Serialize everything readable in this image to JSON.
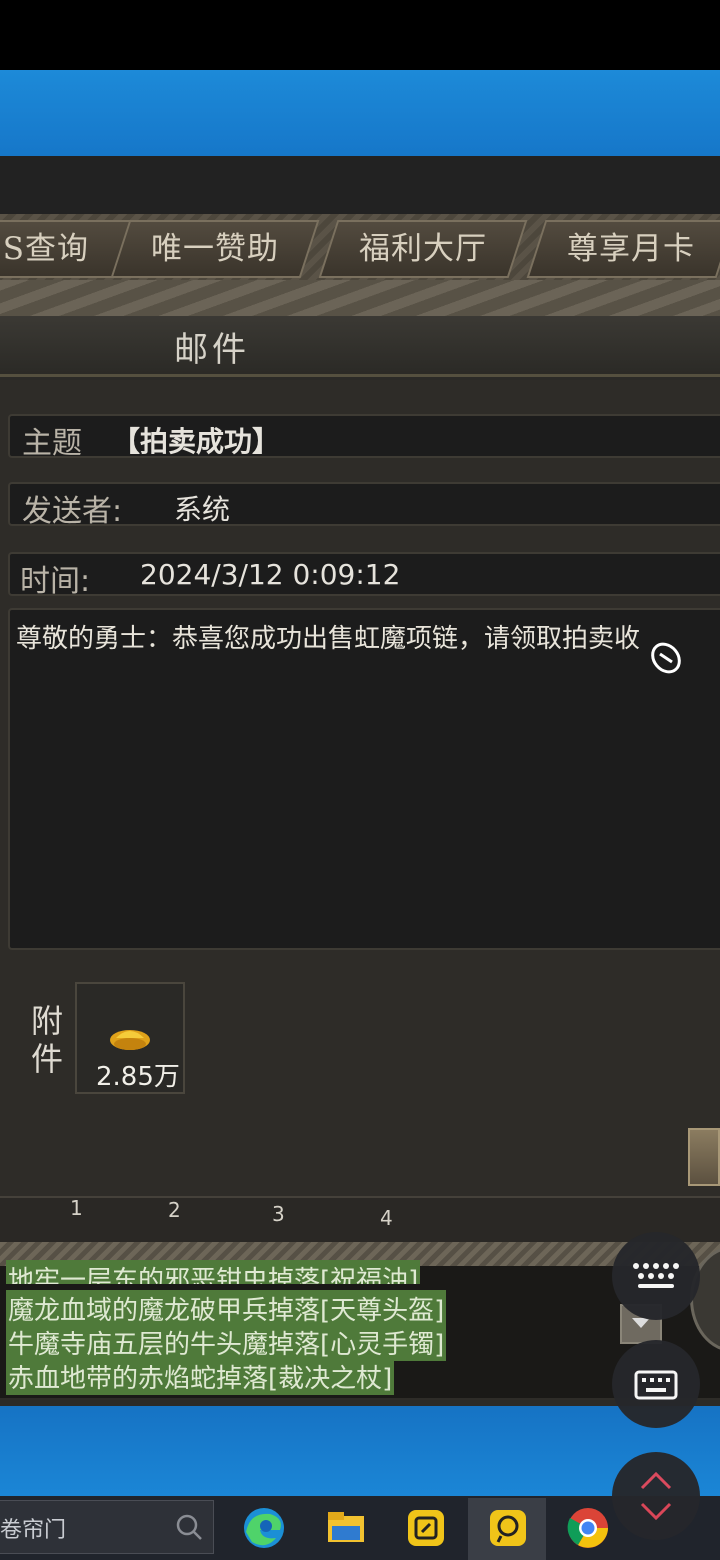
{
  "tabs": [
    "SS查询",
    "唯一赞助",
    "福利大厅",
    "尊享月卡"
  ],
  "mail": {
    "title": "邮件",
    "subject_label": "主题",
    "subject_value": "【拍卖成功】",
    "sender_label": "发送者:",
    "sender_value": "系统",
    "time_label": "时间:",
    "time_value": "2024/3/12 0:09:12",
    "content": "尊敬的勇士：恭喜您成功出售虹魔项链，请领取拍卖收",
    "attachment_label": "附件",
    "attachment_amount": "2.85万"
  },
  "pages": [
    "1",
    "2",
    "3",
    "4"
  ],
  "chat": {
    "lines": [
      "地牢一层东的邪恶钳虫掉落[祝福油]",
      "魔龙血域的魔龙破甲兵掉落[天尊头盔]",
      "牛魔寺庙五层的牛头魔掉落[心灵手镯]",
      "赤血地带的赤焰蛇掉落[裁决之杖]"
    ]
  },
  "taskbar": {
    "search_text": "卷帘门",
    "apps": [
      "edge-icon",
      "file-explorer-icon",
      "app-icon-yellow",
      "app-icon-active",
      "chrome-icon"
    ]
  },
  "colors": {
    "desktop_blue": "#1677c9",
    "chat_highlight": "#4f7a3a",
    "taskbar": "#20242c"
  }
}
